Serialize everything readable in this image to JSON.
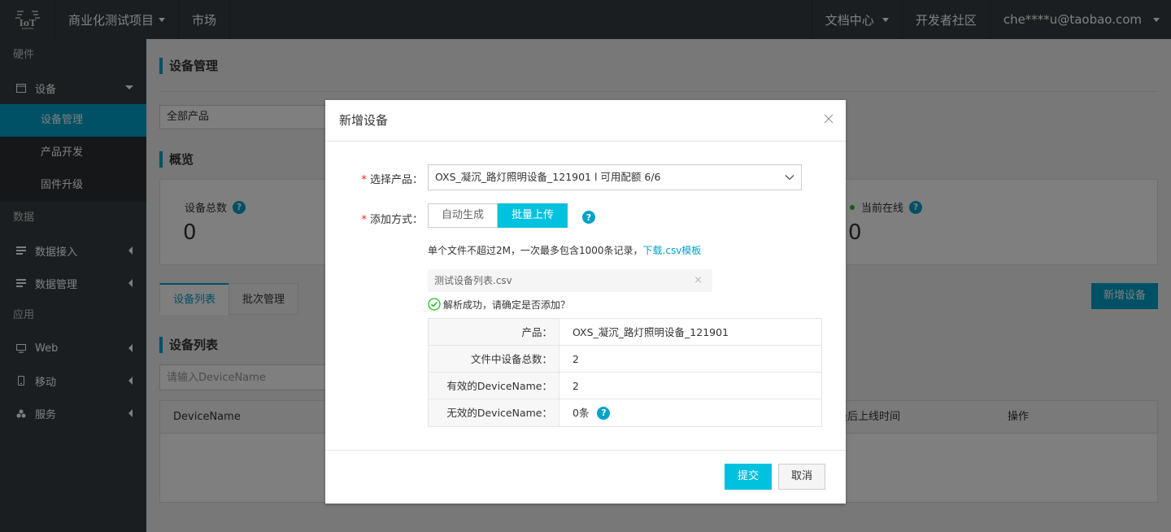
{
  "topbar": {
    "project": "商业化测试项目",
    "market": "市场",
    "docs": "文档中心",
    "community": "开发者社区",
    "user": "che****u@taobao.com"
  },
  "sidebar": {
    "groups": {
      "hardware": "硬件",
      "data": "数据",
      "apps": "应用"
    },
    "items": {
      "device": "设备",
      "device_manage": "设备管理",
      "product_dev": "产品开发",
      "firmware": "固件升级",
      "data_access": "数据接入",
      "data_manage": "数据管理",
      "web": "Web",
      "mobile": "移动",
      "service": "服务"
    }
  },
  "main": {
    "title": "设备管理",
    "product_filter": "全部产品",
    "overview_title": "概览",
    "device_total_label": "设备总数",
    "device_total": "0",
    "online_label": "当前在线",
    "online": "0",
    "tabs": [
      "设备列表",
      "批次管理"
    ],
    "add_device_button": "新增设备",
    "list_title": "设备列表",
    "search_placeholder": "请输入DeviceName",
    "table_headers": [
      "DeviceName",
      "最后上线时间",
      "操作"
    ]
  },
  "modal": {
    "title": "新增设备",
    "product_label": "选择产品：",
    "product_value": "OXS_凝沉_路灯照明设备_121901 l 可用配额 6/6",
    "method_label": "添加方式：",
    "methods": [
      "自动生成",
      "批量上传"
    ],
    "hint_text": "单个文件不超过2M，一次最多包含1000条记录，",
    "hint_link": "下载.csv模板",
    "file_name": "测试设备列表.csv",
    "success_text": "解析成功，请确定是否添加？",
    "info": [
      {
        "key": "产品：",
        "value": "OXS_凝沉_路灯照明设备_121901"
      },
      {
        "key": "文件中设备总数：",
        "value": "2"
      },
      {
        "key": "有效的DeviceName：",
        "value": "2"
      },
      {
        "key": "无效的DeviceName：",
        "value": "0条"
      }
    ],
    "submit": "提交",
    "cancel": "取消"
  },
  "colors": {
    "accent": "#00a2ca",
    "accent_light": "#00c1de",
    "sidebar_bg": "#373d41",
    "required": "#e2231a"
  }
}
